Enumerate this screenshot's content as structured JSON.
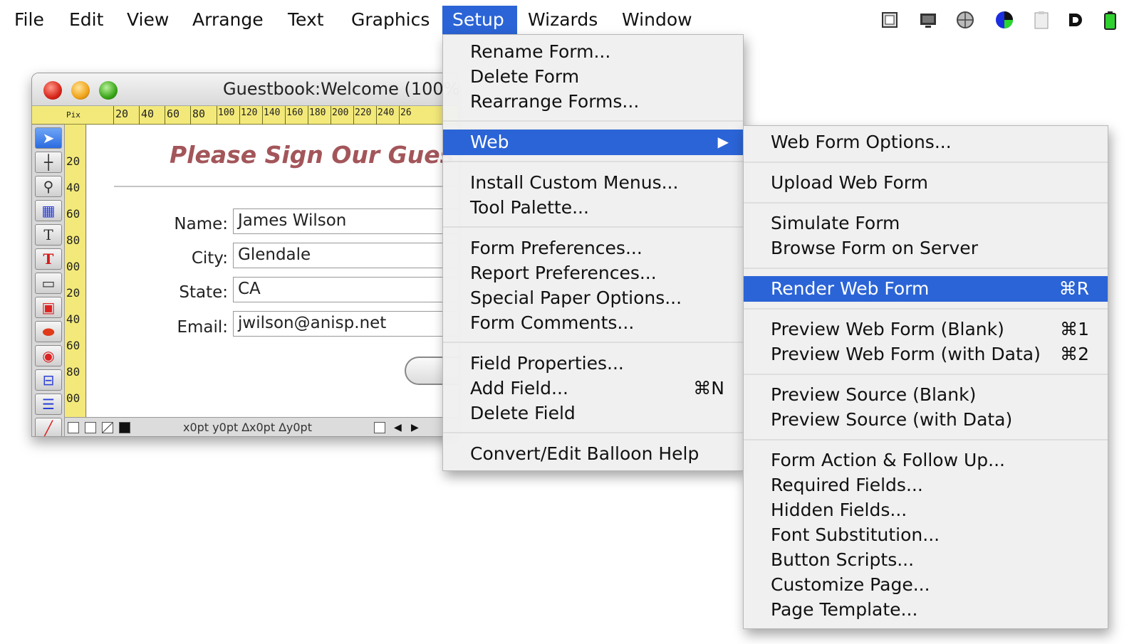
{
  "menubar": {
    "items": [
      "File",
      "Edit",
      "View",
      "Arrange",
      "Text",
      "Graphics",
      "Setup",
      "Wizards",
      "Window"
    ],
    "active": "Setup",
    "accent_color": "#2b64d6",
    "tray_icons": [
      "window-icon",
      "display-icon",
      "globe-icon",
      "color-wheel-icon",
      "clipboard-icon",
      "d-app-icon",
      "battery-icon"
    ]
  },
  "window": {
    "title": "Guestbook:Welcome (100%",
    "ruler_unit": "Pix",
    "ruler_top_labels": [
      "20",
      "40",
      "60",
      "80",
      "100",
      "120",
      "140",
      "160",
      "180",
      "200",
      "220",
      "240",
      "26"
    ],
    "ruler_left_labels": [
      "20",
      "40",
      "60",
      "80",
      "00",
      "20",
      "40",
      "60",
      "80",
      "00"
    ],
    "status_coords": "x0pt y0pt ∆x0pt ∆y0pt"
  },
  "form": {
    "heading": "Please Sign Our Gues",
    "heading_color": "#a3565a",
    "fields": [
      {
        "label": "Name:",
        "value": "James Wilson"
      },
      {
        "label": "City:",
        "value": "Glendale"
      },
      {
        "label": "State:",
        "value": "CA"
      },
      {
        "label": "Email:",
        "value": "jwilson@anisp.net"
      }
    ]
  },
  "setup_menu": {
    "items": [
      {
        "label": "Rename Form...",
        "shortcut": ""
      },
      {
        "label": "Delete Form",
        "shortcut": ""
      },
      {
        "label": "Rearrange Forms...",
        "shortcut": ""
      },
      {
        "label": "Web",
        "shortcut": "",
        "submenu_arrow": "▶"
      },
      {
        "label": "Install Custom Menus...",
        "shortcut": ""
      },
      {
        "label": "Tool Palette...",
        "shortcut": ""
      },
      {
        "label": "Form Preferences...",
        "shortcut": ""
      },
      {
        "label": "Report Preferences...",
        "shortcut": ""
      },
      {
        "label": "Special Paper Options...",
        "shortcut": ""
      },
      {
        "label": "Form Comments...",
        "shortcut": ""
      },
      {
        "label": "Field Properties...",
        "shortcut": ""
      },
      {
        "label": "Add Field...",
        "shortcut": "⌘N"
      },
      {
        "label": "Delete Field",
        "shortcut": ""
      },
      {
        "label": "Convert/Edit Balloon Help",
        "shortcut": ""
      }
    ],
    "highlighted": "Web"
  },
  "web_menu": {
    "items": [
      {
        "label": "Web Form Options...",
        "shortcut": ""
      },
      {
        "label": "Upload Web Form",
        "shortcut": ""
      },
      {
        "label": "Simulate Form",
        "shortcut": ""
      },
      {
        "label": "Browse Form on Server",
        "shortcut": ""
      },
      {
        "label": "Render Web Form",
        "shortcut": "⌘R"
      },
      {
        "label": "Preview Web Form (Blank)",
        "shortcut": "⌘1"
      },
      {
        "label": "Preview Web Form (with Data)",
        "shortcut": "⌘2"
      },
      {
        "label": "Preview Source (Blank)",
        "shortcut": ""
      },
      {
        "label": "Preview Source (with Data)",
        "shortcut": ""
      },
      {
        "label": "Form Action & Follow Up...",
        "shortcut": ""
      },
      {
        "label": "Required Fields...",
        "shortcut": ""
      },
      {
        "label": "Hidden Fields...",
        "shortcut": ""
      },
      {
        "label": "Font Substitution...",
        "shortcut": ""
      },
      {
        "label": "Button Scripts...",
        "shortcut": ""
      },
      {
        "label": "Customize Page...",
        "shortcut": ""
      },
      {
        "label": "Page Template...",
        "shortcut": ""
      }
    ],
    "highlighted": "Render Web Form"
  }
}
